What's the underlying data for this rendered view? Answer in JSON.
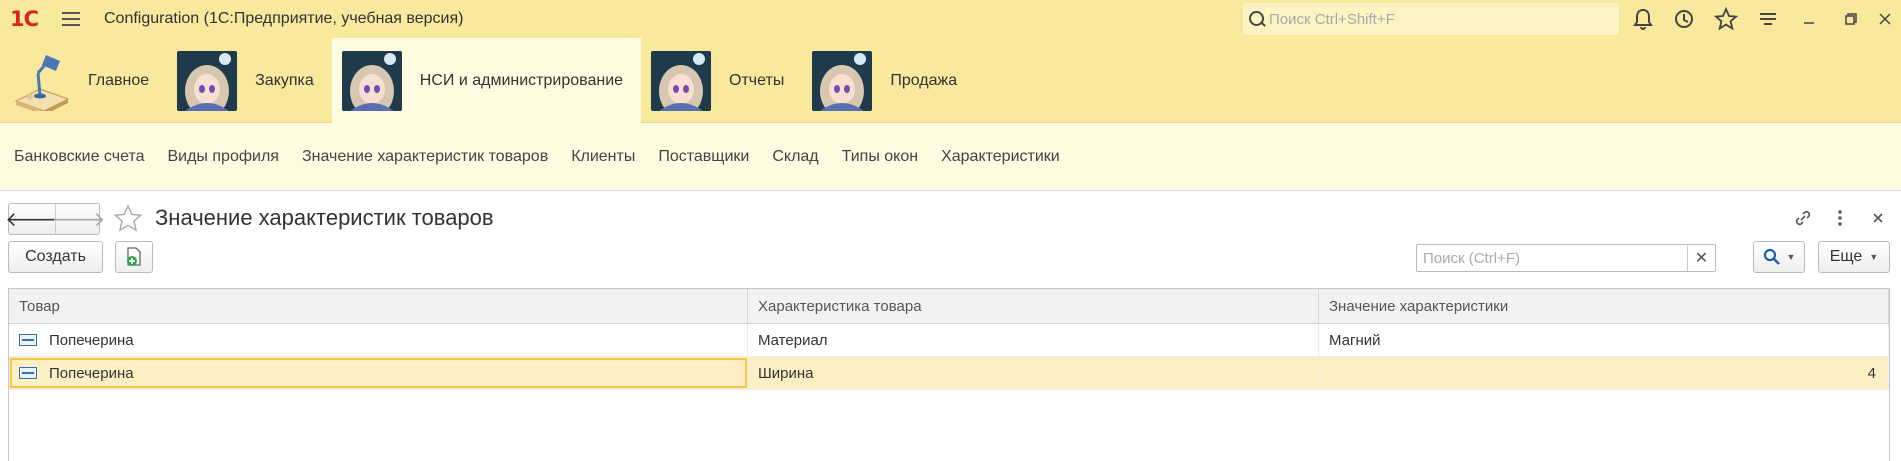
{
  "titlebar": {
    "logo": "1С",
    "title": "Configuration  (1С:Предприятие, учебная версия)",
    "search_placeholder": "Поиск Ctrl+Shift+F",
    "icons": [
      "bell-icon",
      "history-icon",
      "star-icon",
      "menu-lines-icon",
      "minimize-icon",
      "restore-icon",
      "close-icon"
    ]
  },
  "sections": [
    {
      "label": "Главное",
      "icon": "desk-lamp-icon",
      "active": false
    },
    {
      "label": "Закупка",
      "icon": "anime-avatar",
      "active": false
    },
    {
      "label": "НСИ и администрирование",
      "icon": "anime-avatar",
      "active": true
    },
    {
      "label": "Отчеты",
      "icon": "anime-avatar",
      "active": false
    },
    {
      "label": "Продажа",
      "icon": "anime-avatar",
      "active": false
    }
  ],
  "functions": [
    "Банковские счета",
    "Виды профиля",
    "Значение характеристик товаров",
    "Клиенты",
    "Поставщики",
    "Склад",
    "Типы окон",
    "Характеристики"
  ],
  "form": {
    "title": "Значение характеристик товаров",
    "create_label": "Создать",
    "search_placeholder": "Поиск (Ctrl+F)",
    "more_label": "Еще",
    "columns": [
      "Товар",
      "Характеристика товара",
      "Значение характеристики"
    ],
    "rows": [
      {
        "item": "Попечерина",
        "characteristic": "Материал",
        "value": "Магний",
        "selected": false
      },
      {
        "item": "Попечерина",
        "characteristic": "Ширина",
        "value": "4",
        "selected": true
      }
    ]
  },
  "colors": {
    "panel": "#f8e99d",
    "panel_light": "#fefbe0",
    "selection": "#fdefc4",
    "selection_border": "#f4c744",
    "logo_red": "#d9261c"
  }
}
